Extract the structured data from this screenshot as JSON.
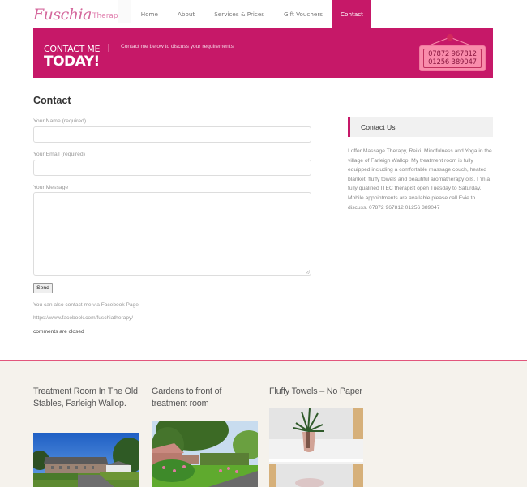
{
  "header": {
    "logo": {
      "script": "Fuschia",
      "sans": "Therapy"
    },
    "nav": [
      {
        "label": "Home",
        "active": false
      },
      {
        "label": "About",
        "active": false
      },
      {
        "label": "Services & Prices",
        "active": false
      },
      {
        "label": "Gift Vouchers",
        "active": false
      },
      {
        "label": "Contact",
        "active": true
      }
    ]
  },
  "banner": {
    "line1": "CONTACT ME",
    "line2": "TODAY!",
    "subtitle": "Contact me below to discuss your requirements",
    "sign_phones": [
      "07872 967812",
      "01256 389047"
    ]
  },
  "main": {
    "title": "Contact",
    "form": {
      "name_label": "Your Name (required)",
      "name_value": "",
      "email_label": "Your Email (required)",
      "email_value": "",
      "message_label": "Your Message",
      "message_value": "",
      "send_label": "Send"
    },
    "facebook_note": "You can also contact me via Facebook Page",
    "facebook_url": "https://www.facebook.com/fuschiatherapy/",
    "comments_status": "comments are closed"
  },
  "sidebar": {
    "widget_title": "Contact Us",
    "widget_text": "I offer Massage Therapy, Reiki, Mindfulness and Yoga in the village of Farleigh Wallop. My treatment room is fully equipped including a comfortable massage couch, heated blanket, fluffy towels and beautiful aromatherapy oils. I 'm a fully qualified ITEC therapist open Tuesday to Saturday. Mobile appointments are available please call Evie to discuss. 07872 967812 01256 389047"
  },
  "gallery": [
    {
      "title": "Treatment Room In The Old Stables, Farleigh Wallop.",
      "image": "stables-photo"
    },
    {
      "title": "Gardens to front of treatment room",
      "image": "garden-photo"
    },
    {
      "title": "Fluffy Towels – No Paper",
      "image": "towels-plant-photo"
    }
  ],
  "colors": {
    "brand": "#c61868",
    "sign": "#f98cab",
    "footer_bg": "#f5f2ec",
    "footer_rule": "#e2567c"
  }
}
